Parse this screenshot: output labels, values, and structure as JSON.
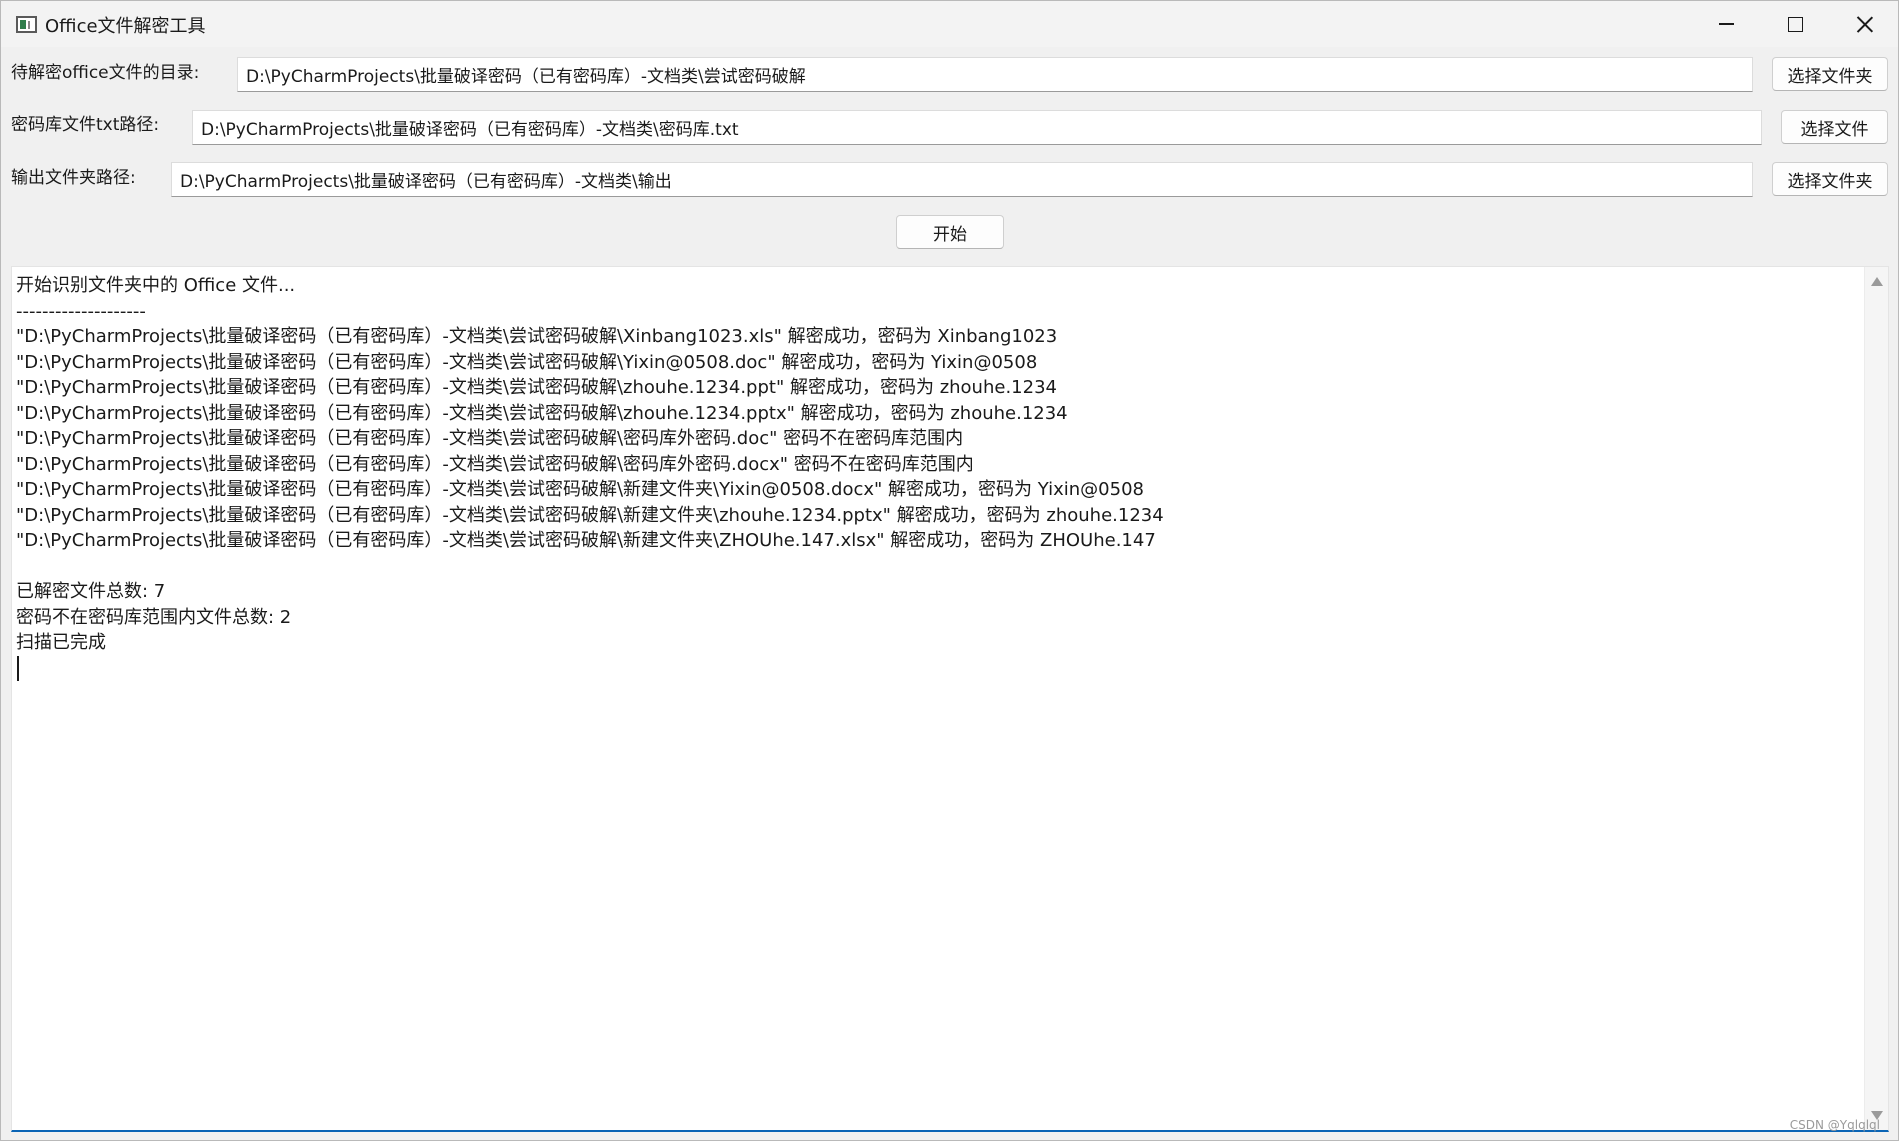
{
  "window": {
    "title": "Office文件解密工具",
    "icon": "app-window-icon",
    "controls": {
      "minimize": "minimize-icon",
      "maximize": "maximize-icon",
      "close": "close-icon"
    }
  },
  "form": {
    "source_dir": {
      "label": "待解密office文件的目录:",
      "value": "D:\\PyCharmProjects\\批量破译密码（已有密码库）-文档类\\尝试密码破解",
      "button": "选择文件夹"
    },
    "password_file": {
      "label": "密码库文件txt路径:",
      "value": "D:\\PyCharmProjects\\批量破译密码（已有密码库）-文档类\\密码库.txt",
      "button": "选择文件"
    },
    "output_dir": {
      "label": "输出文件夹路径:",
      "value": "D:\\PyCharmProjects\\批量破译密码（已有密码库）-文档类\\输出",
      "button": "选择文件夹"
    },
    "start_button": "开始"
  },
  "log": {
    "lines": [
      "开始识别文件夹中的 Office 文件...",
      "--------------------",
      "\"D:\\PyCharmProjects\\批量破译密码（已有密码库）-文档类\\尝试密码破解\\Xinbang1023.xls\" 解密成功，密码为 Xinbang1023",
      "\"D:\\PyCharmProjects\\批量破译密码（已有密码库）-文档类\\尝试密码破解\\Yixin@0508.doc\" 解密成功，密码为 Yixin@0508",
      "\"D:\\PyCharmProjects\\批量破译密码（已有密码库）-文档类\\尝试密码破解\\zhouhe.1234.ppt\" 解密成功，密码为 zhouhe.1234",
      "\"D:\\PyCharmProjects\\批量破译密码（已有密码库）-文档类\\尝试密码破解\\zhouhe.1234.pptx\" 解密成功，密码为 zhouhe.1234",
      "\"D:\\PyCharmProjects\\批量破译密码（已有密码库）-文档类\\尝试密码破解\\密码库外密码.doc\" 密码不在密码库范围内",
      "\"D:\\PyCharmProjects\\批量破译密码（已有密码库）-文档类\\尝试密码破解\\密码库外密码.docx\" 密码不在密码库范围内",
      "\"D:\\PyCharmProjects\\批量破译密码（已有密码库）-文档类\\尝试密码破解\\新建文件夹\\Yixin@0508.docx\" 解密成功，密码为 Yixin@0508",
      "\"D:\\PyCharmProjects\\批量破译密码（已有密码库）-文档类\\尝试密码破解\\新建文件夹\\zhouhe.1234.pptx\" 解密成功，密码为 zhouhe.1234",
      "\"D:\\PyCharmProjects\\批量破译密码（已有密码库）-文档类\\尝试密码破解\\新建文件夹\\ZHOUhe.147.xlsx\" 解密成功，密码为 ZHOUhe.147",
      "",
      "已解密文件总数: 7",
      "密码不在密码库范围内文件总数: 2",
      "扫描已完成"
    ]
  },
  "watermark": "CSDN @Yqlqlql"
}
